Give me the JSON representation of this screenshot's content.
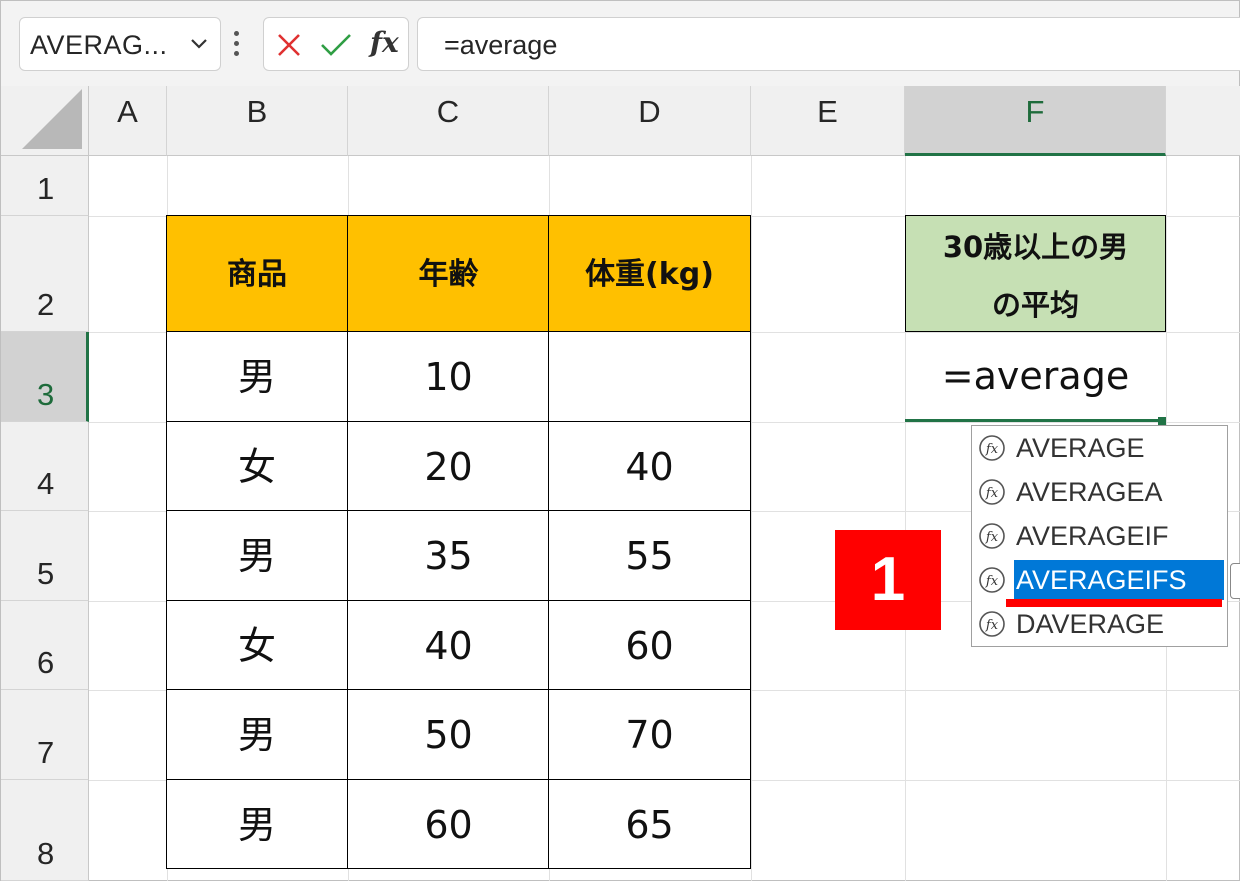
{
  "formula_bar": {
    "name_box": "AVERAG...",
    "cancel_icon": "x-icon",
    "enter_icon": "check-icon",
    "fx_label": "fx",
    "formula_text": "=average"
  },
  "columns": [
    "A",
    "B",
    "C",
    "D",
    "E",
    "F"
  ],
  "rows": [
    "1",
    "2",
    "3",
    "4",
    "5",
    "6",
    "7",
    "8"
  ],
  "selected_column": "F",
  "selected_row": "3",
  "table": {
    "headers": [
      "商品",
      "年齢",
      "体重(kg)"
    ],
    "data": [
      [
        "男",
        "10",
        ""
      ],
      [
        "女",
        "20",
        "40"
      ],
      [
        "男",
        "35",
        "55"
      ],
      [
        "女",
        "40",
        "60"
      ],
      [
        "男",
        "50",
        "70"
      ],
      [
        "男",
        "60",
        "65"
      ]
    ]
  },
  "result_header": {
    "line1": "30歳以上の男",
    "line2": "の平均"
  },
  "editing_cell_text": "=average",
  "autocomplete": {
    "items": [
      "AVERAGE",
      "AVERAGEA",
      "AVERAGEIF",
      "AVERAGEIFS",
      "DAVERAGE"
    ],
    "highlighted_index": 3
  },
  "step_badge": "1",
  "colors": {
    "header_fill": "#ffc000",
    "result_header_fill": "#c6e0b4",
    "selection_green": "#217346",
    "highlight_blue": "#0078d7",
    "badge_red": "#ff0000"
  }
}
